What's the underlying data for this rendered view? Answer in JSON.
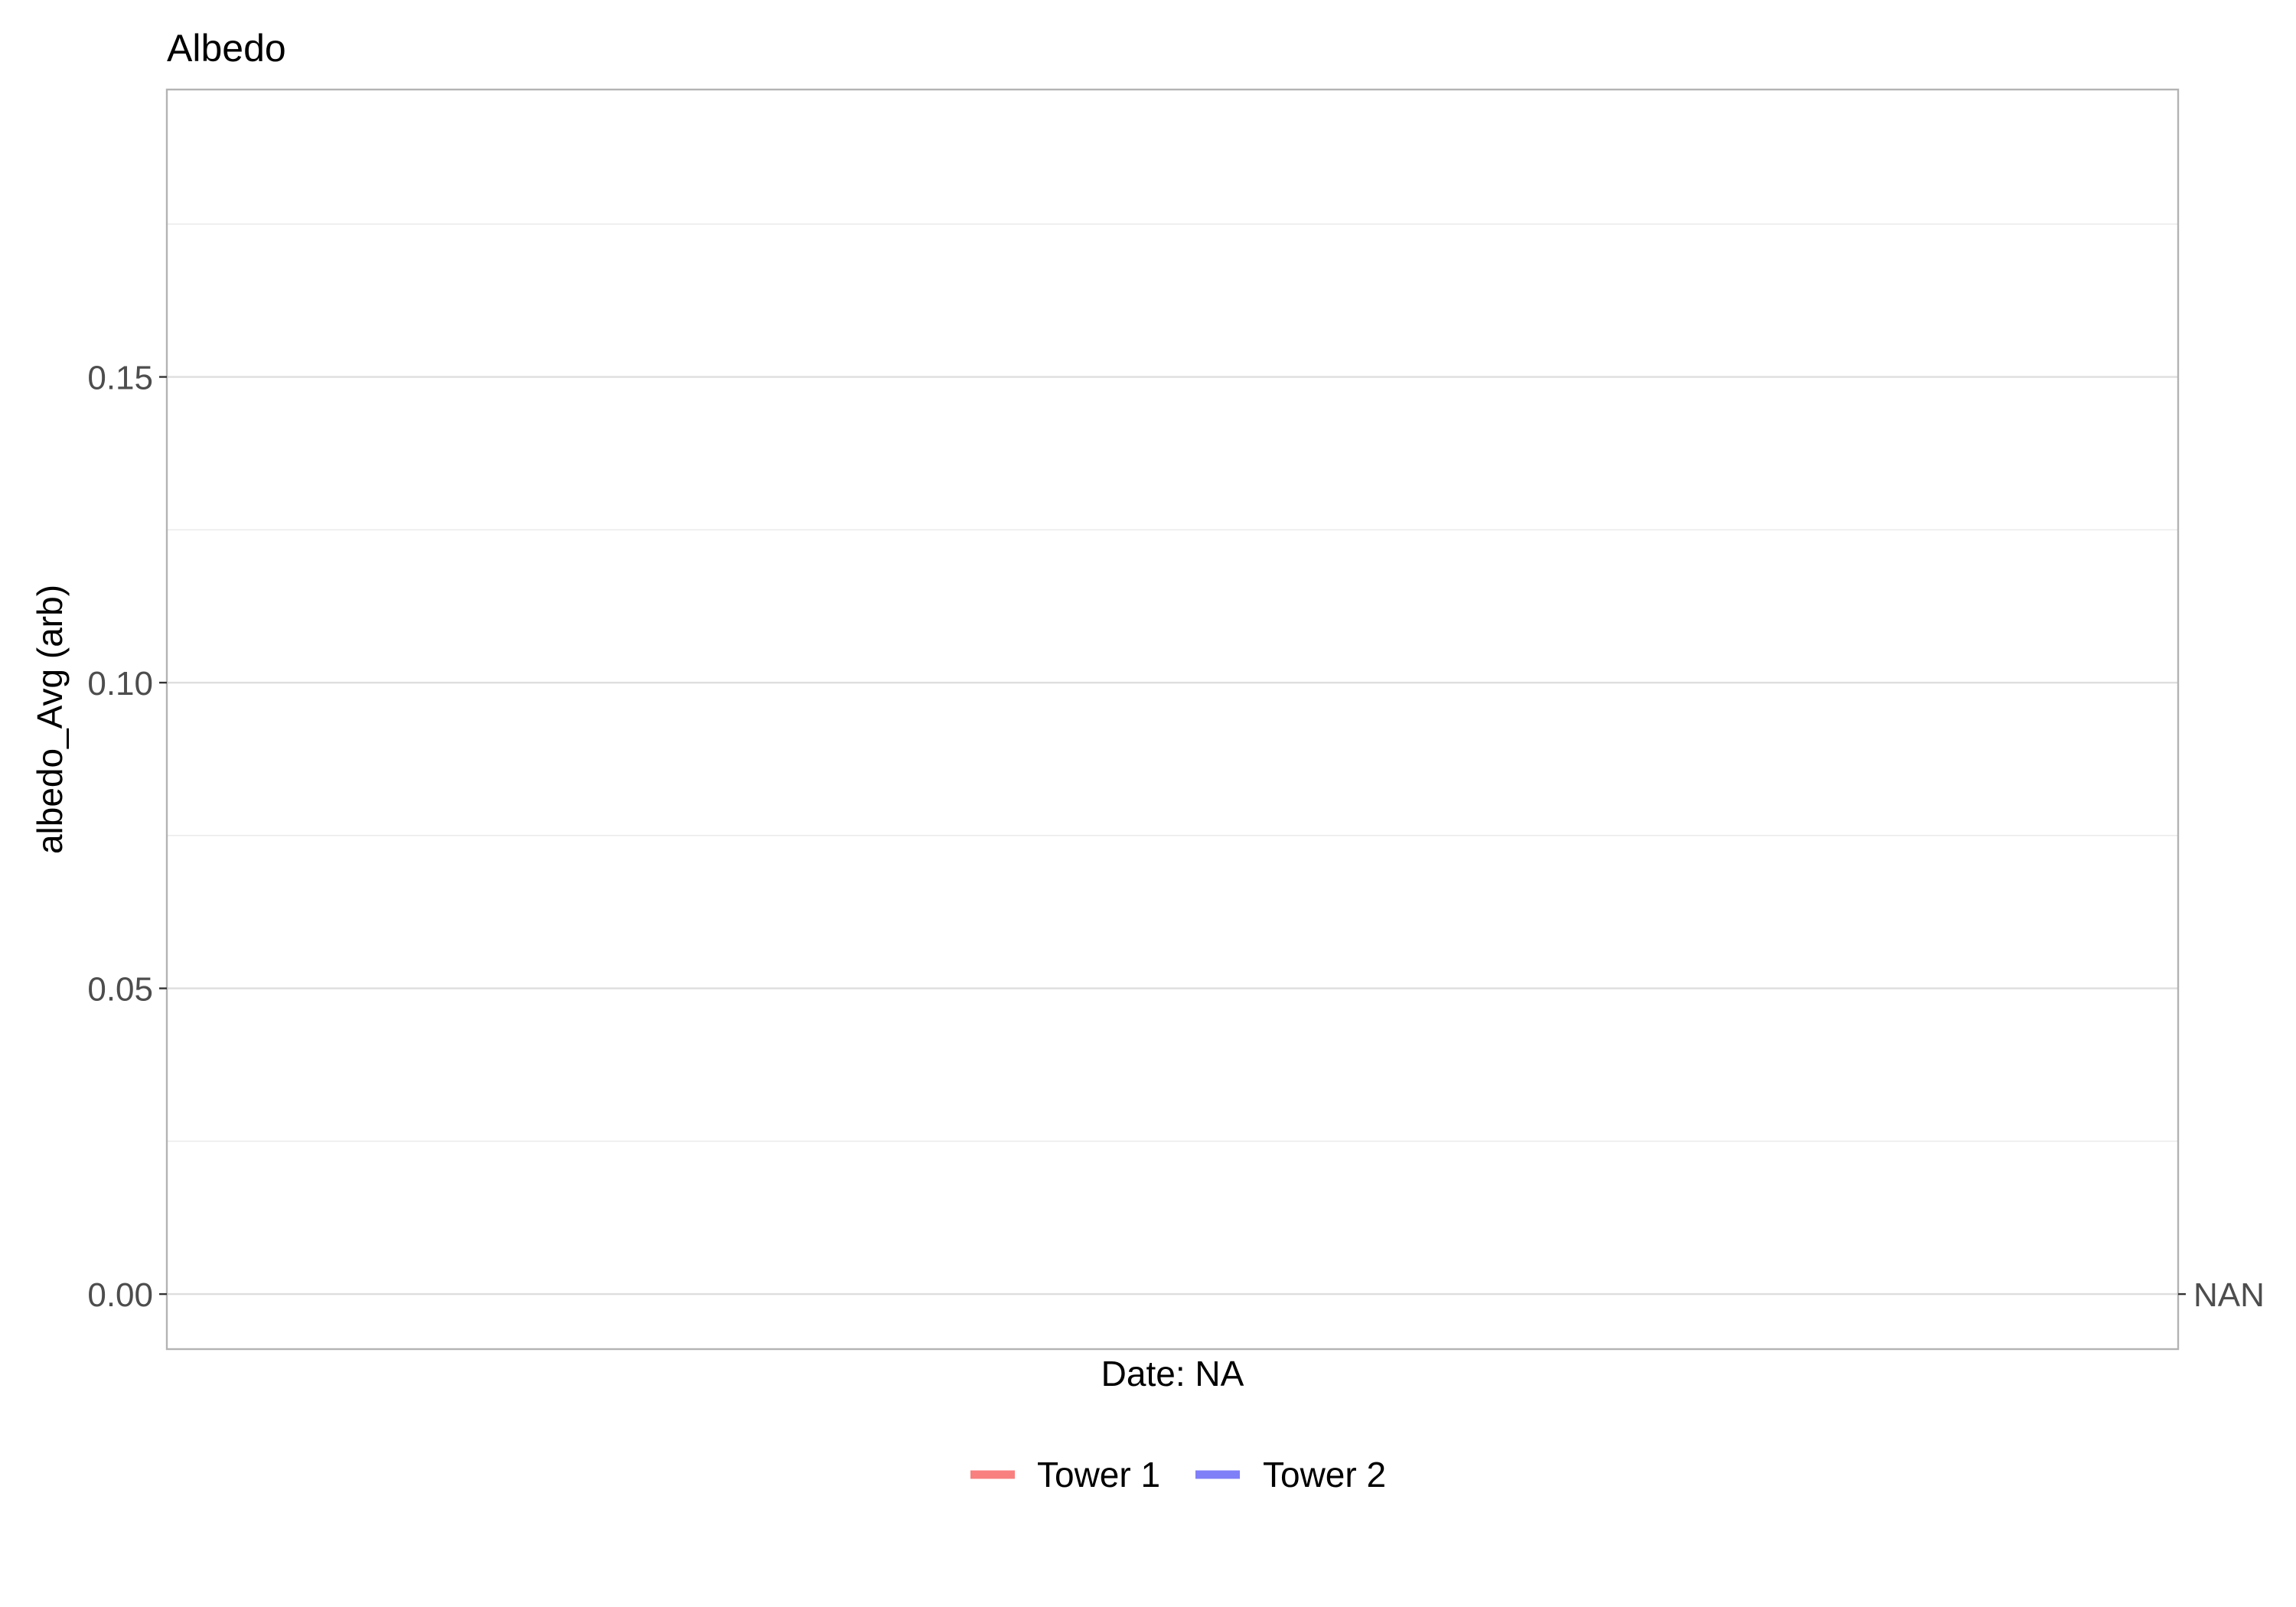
{
  "chart_data": {
    "type": "line",
    "title": "Albedo",
    "xlabel": "Date: NA",
    "ylabel": "albedo_Avg (arb)",
    "ylim": [
      -0.009,
      0.197
    ],
    "y_ticks": [
      {
        "value": 0.0,
        "label": "0.00"
      },
      {
        "value": 0.05,
        "label": "0.05"
      },
      {
        "value": 0.1,
        "label": "0.10"
      },
      {
        "value": 0.15,
        "label": "0.15"
      }
    ],
    "y_minor_ticks": [
      0.025,
      0.075,
      0.125,
      0.175
    ],
    "secondary_axis_tick": {
      "value": 0.0,
      "label": "NAN"
    },
    "grid": true,
    "legend_position": "bottom",
    "series": [
      {
        "name": "Tower 1",
        "color": "#f8807f",
        "values": []
      },
      {
        "name": "Tower 2",
        "color": "#7f7ff8",
        "values": []
      }
    ]
  }
}
